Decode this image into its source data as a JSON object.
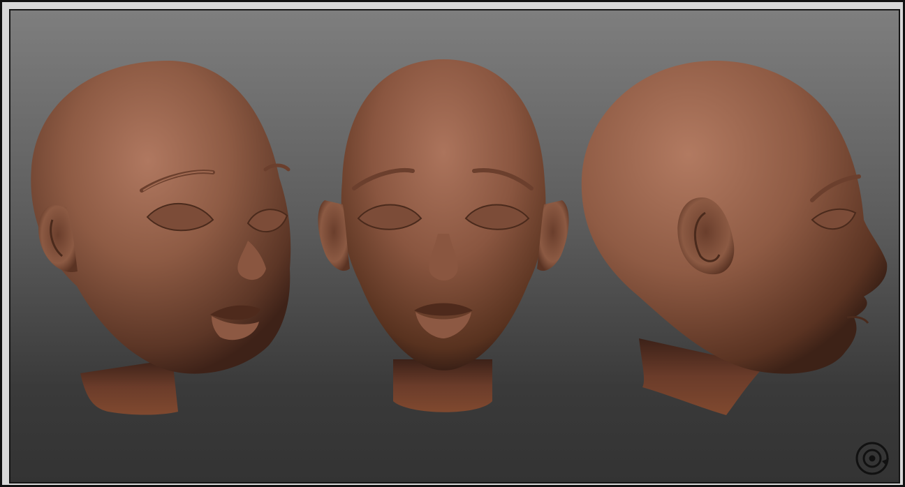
{
  "scene": {
    "type": "3d-sculpt-turnaround",
    "views": [
      "three-quarter",
      "front",
      "profile"
    ],
    "material_color": "#8a5a44",
    "background_top": "#7e7e7e",
    "background_bottom": "#333333"
  },
  "logo": {
    "icon": "circular-target-logo-icon"
  }
}
